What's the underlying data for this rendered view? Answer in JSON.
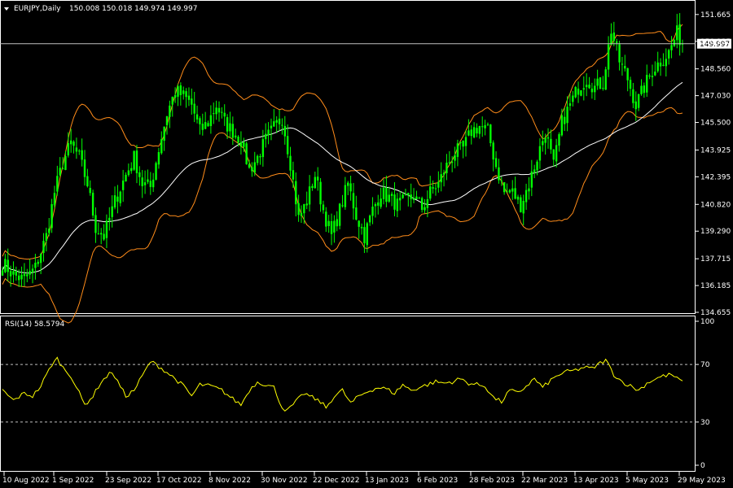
{
  "header": {
    "symbol": "EURJPY,Daily",
    "ohlc": "150.008 150.018 149.974 149.997",
    "rsi_label": "RSI(14) 58.5794"
  },
  "colors": {
    "background": "#000000",
    "candle": "#00ff00",
    "bands": "#ff8c1a",
    "ma": "#ffffff",
    "rsi": "#ffff00",
    "levels": "#c0c0c0",
    "text": "#ffffff"
  },
  "chart_data": [
    {
      "type": "candlestick",
      "title": "EURJPY,Daily",
      "ylim": [
        134.655,
        152.4
      ],
      "y_ticks": [
        "151.665",
        "150.135",
        "148.560",
        "147.030",
        "145.500",
        "143.925",
        "142.395",
        "140.820",
        "139.290",
        "137.715",
        "136.185",
        "134.655"
      ],
      "price_line": {
        "value": 149.997,
        "label": "149.997"
      },
      "x_ticks": [
        "10 Aug 2022",
        "1 Sep 2022",
        "23 Sep 2022",
        "17 Oct 2022",
        "8 Nov 2022",
        "30 Nov 2022",
        "22 Dec 2022",
        "13 Jan 2023",
        "6 Feb 2023",
        "28 Feb 2023",
        "22 Mar 2023",
        "13 Apr 2023",
        "5 May 2023",
        "29 May 2023"
      ],
      "close_anchors": [
        [
          0,
          137.5
        ],
        [
          4,
          136.8
        ],
        [
          8,
          136.5
        ],
        [
          12,
          137.2
        ],
        [
          16,
          139.0
        ],
        [
          19,
          141.5
        ],
        [
          22,
          143.2
        ],
        [
          25,
          144.3
        ],
        [
          28,
          143.5
        ],
        [
          31,
          142.0
        ],
        [
          34,
          139.5
        ],
        [
          37,
          139.0
        ],
        [
          41,
          141.0
        ],
        [
          45,
          142.5
        ],
        [
          48,
          143.5
        ],
        [
          51,
          142.0
        ],
        [
          54,
          141.8
        ],
        [
          57,
          144.0
        ],
        [
          60,
          146.0
        ],
        [
          63,
          147.3
        ],
        [
          66,
          147.0
        ],
        [
          69,
          146.5
        ],
        [
          72,
          145.0
        ],
        [
          75,
          145.5
        ],
        [
          78,
          146.5
        ],
        [
          81,
          145.5
        ],
        [
          84,
          145.0
        ],
        [
          87,
          144.5
        ],
        [
          90,
          142.8
        ],
        [
          93,
          143.5
        ],
        [
          96,
          144.5
        ],
        [
          99,
          145.2
        ],
        [
          102,
          145.8
        ],
        [
          105,
          143.2
        ],
        [
          108,
          140.0
        ],
        [
          111,
          141.0
        ],
        [
          114,
          142.5
        ],
        [
          117,
          140.5
        ],
        [
          120,
          139.0
        ],
        [
          123,
          140.5
        ],
        [
          126,
          142.0
        ],
        [
          129,
          140.2
        ],
        [
          132,
          139.0
        ],
        [
          135,
          140.5
        ],
        [
          138,
          141.5
        ],
        [
          141,
          141.2
        ],
        [
          144,
          140.8
        ],
        [
          147,
          141.0
        ],
        [
          150,
          141.3
        ],
        [
          153,
          140.6
        ],
        [
          156,
          141.5
        ],
        [
          159,
          142.0
        ],
        [
          162,
          143.0
        ],
        [
          165,
          143.8
        ],
        [
          168,
          144.0
        ],
        [
          171,
          145.0
        ],
        [
          174,
          145.3
        ],
        [
          177,
          145.0
        ],
        [
          180,
          143.0
        ],
        [
          183,
          141.5
        ],
        [
          186,
          141.5
        ],
        [
          189,
          140.8
        ],
        [
          192,
          142.0
        ],
        [
          195,
          143.5
        ],
        [
          198,
          145.0
        ],
        [
          201,
          143.0
        ],
        [
          204,
          145.5
        ],
        [
          207,
          146.5
        ],
        [
          210,
          147.5
        ],
        [
          213,
          148.0
        ],
        [
          216,
          147.5
        ],
        [
          219,
          147.8
        ],
        [
          222,
          150.8
        ],
        [
          225,
          149.0
        ],
        [
          228,
          148.0
        ],
        [
          231,
          146.5
        ],
        [
          234,
          147.5
        ],
        [
          237,
          148.5
        ],
        [
          240,
          149.0
        ],
        [
          243,
          149.5
        ],
        [
          246,
          150.6
        ],
        [
          248,
          149.997
        ]
      ],
      "series": [
        {
          "name": "Close",
          "values": [
            137.5,
            145.3,
            140.1,
            141.9,
            144.4,
            143.7,
            142.7,
            140.6,
            142.2,
            140.7,
            143.2,
            145.3,
            145.0,
            143.5,
            146.2,
            147.9,
            147.8,
            148.3,
            149.6
          ]
        },
        {
          "name": "Bands",
          "values": []
        },
        {
          "name": "MA",
          "values": []
        }
      ]
    },
    {
      "type": "line",
      "title": "RSI(14) 58.5794",
      "ylim": [
        0,
        100
      ],
      "y_ticks": [
        "100",
        "70",
        "30",
        "0"
      ],
      "levels": [
        70,
        30
      ],
      "last_value": 58.5794,
      "rsi_anchors": [
        [
          0,
          52
        ],
        [
          4,
          45
        ],
        [
          8,
          50
        ],
        [
          11,
          48
        ],
        [
          14,
          55
        ],
        [
          18,
          70
        ],
        [
          20,
          74
        ],
        [
          22,
          68
        ],
        [
          25,
          62
        ],
        [
          28,
          50
        ],
        [
          30,
          42
        ],
        [
          33,
          48
        ],
        [
          36,
          58
        ],
        [
          40,
          65
        ],
        [
          42,
          58
        ],
        [
          45,
          48
        ],
        [
          48,
          52
        ],
        [
          51,
          62
        ],
        [
          54,
          72
        ],
        [
          56,
          70
        ],
        [
          59,
          66
        ],
        [
          63,
          60
        ],
        [
          66,
          55
        ],
        [
          69,
          48
        ],
        [
          72,
          56
        ],
        [
          76,
          55
        ],
        [
          80,
          52
        ],
        [
          84,
          46
        ],
        [
          87,
          42
        ],
        [
          90,
          52
        ],
        [
          93,
          58
        ],
        [
          96,
          56
        ],
        [
          99,
          54
        ],
        [
          102,
          40
        ],
        [
          104,
          38
        ],
        [
          107,
          44
        ],
        [
          110,
          50
        ],
        [
          113,
          47
        ],
        [
          116,
          44
        ],
        [
          118,
          40
        ],
        [
          121,
          48
        ],
        [
          124,
          52
        ],
        [
          127,
          43
        ],
        [
          130,
          48
        ],
        [
          134,
          52
        ],
        [
          137,
          54
        ],
        [
          140,
          53
        ],
        [
          143,
          50
        ],
        [
          146,
          56
        ],
        [
          149,
          52
        ],
        [
          152,
          54
        ],
        [
          155,
          56
        ],
        [
          158,
          58
        ],
        [
          161,
          57
        ],
        [
          164,
          58
        ],
        [
          167,
          60
        ],
        [
          170,
          57
        ],
        [
          173,
          56
        ],
        [
          176,
          55
        ],
        [
          179,
          47
        ],
        [
          182,
          44
        ],
        [
          185,
          52
        ],
        [
          188,
          50
        ],
        [
          191,
          55
        ],
        [
          194,
          60
        ],
        [
          197,
          54
        ],
        [
          200,
          59
        ],
        [
          203,
          63
        ],
        [
          206,
          65
        ],
        [
          209,
          66
        ],
        [
          212,
          68
        ],
        [
          215,
          67
        ],
        [
          218,
          71
        ],
        [
          220,
          73
        ],
        [
          223,
          63
        ],
        [
          226,
          58
        ],
        [
          229,
          55
        ],
        [
          232,
          52
        ],
        [
          235,
          57
        ],
        [
          238,
          60
        ],
        [
          241,
          62
        ],
        [
          244,
          63
        ],
        [
          246,
          60
        ],
        [
          248,
          58.58
        ]
      ]
    }
  ]
}
